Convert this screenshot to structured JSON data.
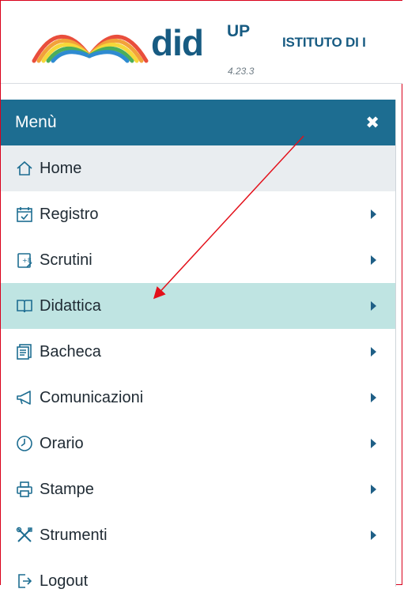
{
  "header": {
    "brand": "did",
    "brand_sup": "UP",
    "version": "4.23.3",
    "school": "ISTITUTO DI I"
  },
  "menu": {
    "title": "Menù",
    "close_icon": "close-x-icon",
    "items": [
      {
        "label": "Home",
        "icon": "home-icon",
        "submenu": false
      },
      {
        "label": "Registro",
        "icon": "calendar-check-icon",
        "submenu": true
      },
      {
        "label": "Scrutini",
        "icon": "grade-report-icon",
        "submenu": true
      },
      {
        "label": "Didattica",
        "icon": "book-open-icon",
        "submenu": true,
        "active": true
      },
      {
        "label": "Bacheca",
        "icon": "notice-board-icon",
        "submenu": true
      },
      {
        "label": "Comunicazioni",
        "icon": "megaphone-icon",
        "submenu": true
      },
      {
        "label": "Orario",
        "icon": "clock-icon",
        "submenu": true
      },
      {
        "label": "Stampe",
        "icon": "printer-icon",
        "submenu": true
      },
      {
        "label": "Strumenti",
        "icon": "tools-icon",
        "submenu": true
      },
      {
        "label": "Logout",
        "icon": "logout-icon",
        "submenu": false
      }
    ]
  },
  "colors": {
    "menu_header": "#1d6d91",
    "active_item": "#bfe4e2",
    "home_item": "#e9edf0",
    "annotation": "#e3101a"
  }
}
